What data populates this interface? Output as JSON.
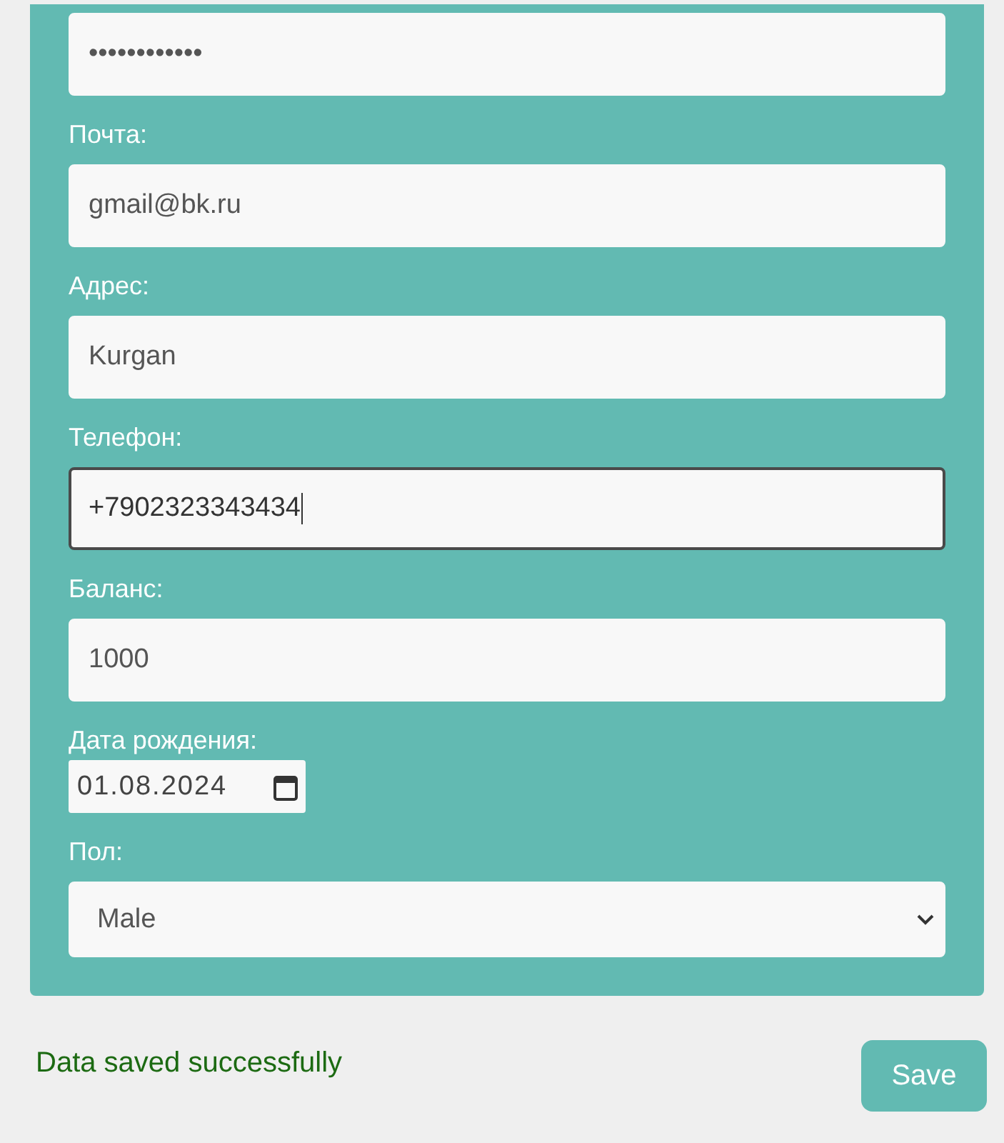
{
  "form": {
    "fields": [
      {
        "kind": "password",
        "value": "••••••••••••",
        "focused": false
      },
      {
        "kind": "text",
        "label": "Почта:",
        "value": "gmail@bk.ru",
        "focused": false
      },
      {
        "kind": "text",
        "label": "Адрес:",
        "value": "Kurgan",
        "focused": false
      },
      {
        "kind": "text",
        "label": "Телефон:",
        "value": "+7902323343434",
        "focused": true
      },
      {
        "kind": "text",
        "label": "Баланс:",
        "value": "1000",
        "focused": false
      },
      {
        "kind": "date",
        "label": "Дата рождения:",
        "value": "01.08.2024",
        "focused": false
      },
      {
        "kind": "select",
        "label": "Пол:",
        "value": "Male",
        "focused": false
      }
    ]
  },
  "status_message": "Data saved successfully",
  "save_button": "Save"
}
